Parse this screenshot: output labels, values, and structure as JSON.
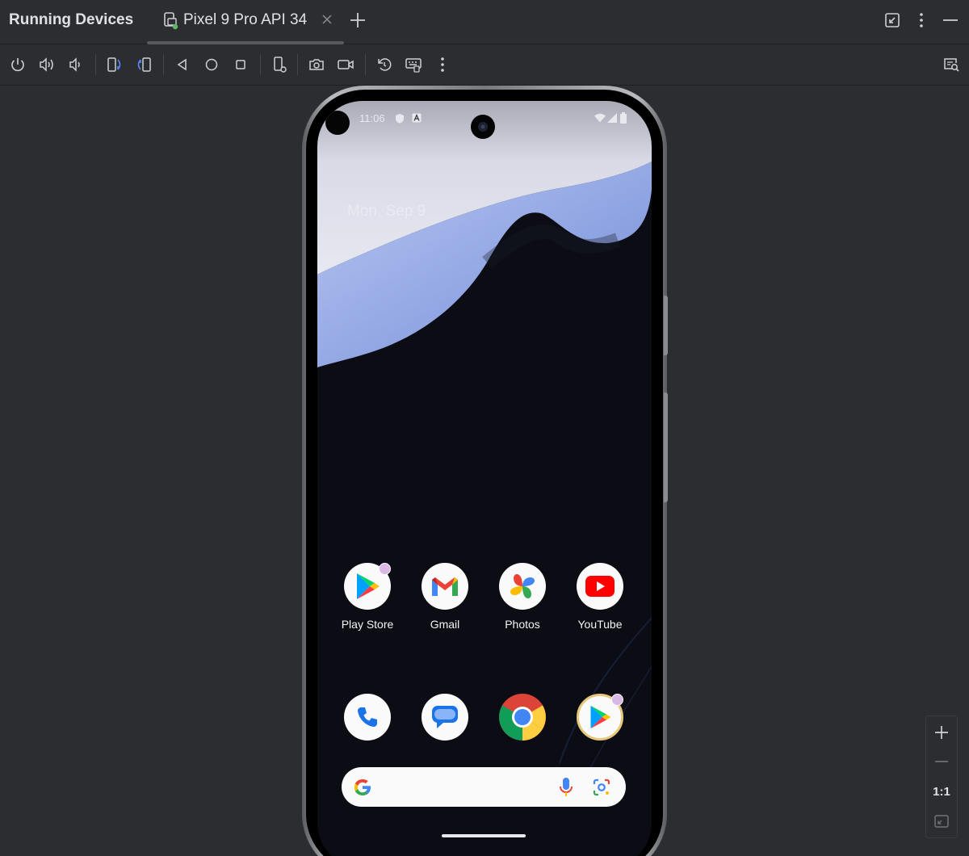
{
  "window": {
    "tool_title": "Running Devices",
    "tab_label": "Pixel 9 Pro API 34"
  },
  "zoom": {
    "one_to_one_label": "1:1"
  },
  "device": {
    "status_time": "11:06",
    "date": "Mon, Sep 9",
    "apps_row1": [
      {
        "label": "Play Store",
        "icon": "play-store-icon"
      },
      {
        "label": "Gmail",
        "icon": "gmail-icon"
      },
      {
        "label": "Photos",
        "icon": "photos-icon"
      },
      {
        "label": "YouTube",
        "icon": "youtube-icon"
      }
    ],
    "dock": [
      {
        "icon": "phone-icon"
      },
      {
        "icon": "messages-icon"
      },
      {
        "icon": "chrome-icon"
      },
      {
        "icon": "play-games-icon"
      }
    ]
  },
  "colors": {
    "ide_background": "#2b2d30",
    "accent_blue": "#548af7",
    "status_green": "#5fb865"
  }
}
